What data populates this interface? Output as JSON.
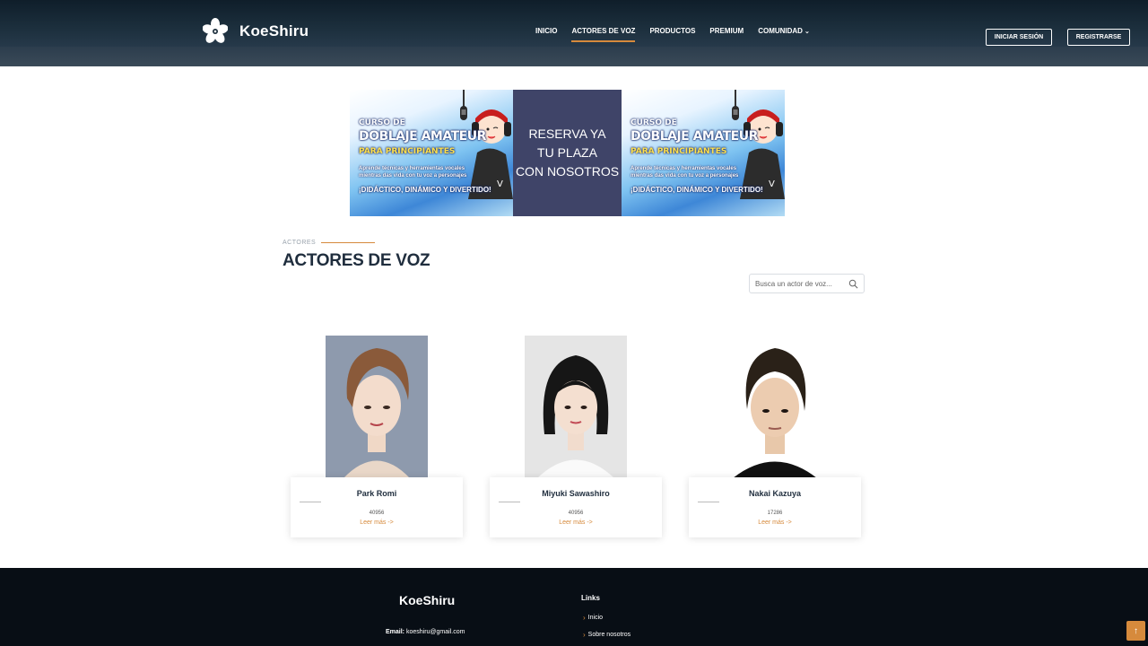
{
  "brand": {
    "name": "KoeShiru",
    "logo_icon": "sakura-flower-icon"
  },
  "nav": {
    "items": [
      {
        "label": "INICIO",
        "active": false
      },
      {
        "label": "ACTORES DE VOZ",
        "active": true
      },
      {
        "label": "PRODUCTOS",
        "active": false
      },
      {
        "label": "PREMIUM",
        "active": false
      },
      {
        "label": "COMUNIDAD",
        "active": false,
        "dropdown": true
      }
    ],
    "login_label": "INICIAR SESIÓN",
    "register_label": "REGISTRARSE"
  },
  "banner": {
    "promo": {
      "line1": "CURSO DE",
      "line2": "DOBLAJE AMATEUR",
      "line3": "PARA PRINCIPIANTES",
      "line4": "Aprende técnicas y herramientas vocales mientras das vida con tu voz a personajes",
      "line5": "¡DIDÁCTICO, DINÁMICO Y DIVERTIDO!"
    },
    "cta_line1": "RESERVA YA",
    "cta_line2": "TU PLAZA",
    "cta_line3": "CON NOSOTROS"
  },
  "section": {
    "eyebrow": "ACTORES",
    "title": "ACTORES DE VOZ",
    "search_placeholder": "Busca un actor de voz..."
  },
  "actors": [
    {
      "name": "Park Romi",
      "count": "40956",
      "more": "Leer más ->"
    },
    {
      "name": "Miyuki Sawashiro",
      "count": "40956",
      "more": "Leer más ->"
    },
    {
      "name": "Nakai Kazuya",
      "count": "17286",
      "more": "Leer más ->"
    }
  ],
  "footer": {
    "brand": "KoeShiru",
    "email_label": "Email:",
    "email_value": "koeshiru@gmail.com",
    "links_title": "Links",
    "links": [
      "Inicio",
      "Sobre nosotros"
    ]
  },
  "back_to_top_icon": "arrow-up-icon",
  "colors": {
    "accent": "#d68a3c",
    "header": "#1c2f3d",
    "footer": "#080e15",
    "banner_mid": "#3f4468"
  }
}
